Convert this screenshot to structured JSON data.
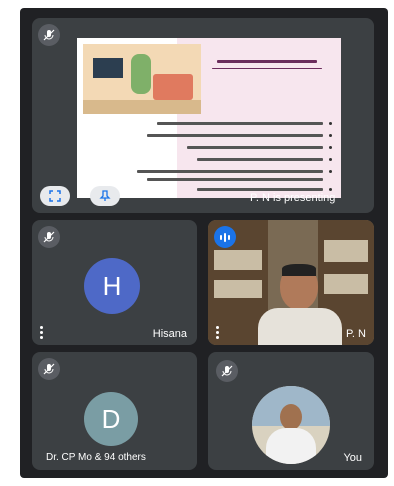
{
  "presentation": {
    "presenter_label": "P. N is presenting",
    "slide": {
      "heading": "............................",
      "bullet_count": 7
    },
    "icons": [
      "fullscreen-icon",
      "pin-icon",
      "mic-off-icon"
    ]
  },
  "participants": [
    {
      "name": "Hisana",
      "initial": "H",
      "avatar_color": "#4e69c7",
      "muted": true
    },
    {
      "name": "P. N",
      "speaking": true,
      "video": true
    },
    {
      "name": "Dr. CP Mo",
      "initial": "D",
      "avatar_color": "#7a9da4",
      "extra": "& 94 others",
      "muted": true
    },
    {
      "name": "You",
      "muted": true
    }
  ],
  "colors": {
    "background": "#202124",
    "tile": "#3c4043",
    "accent": "#1a73e8"
  }
}
